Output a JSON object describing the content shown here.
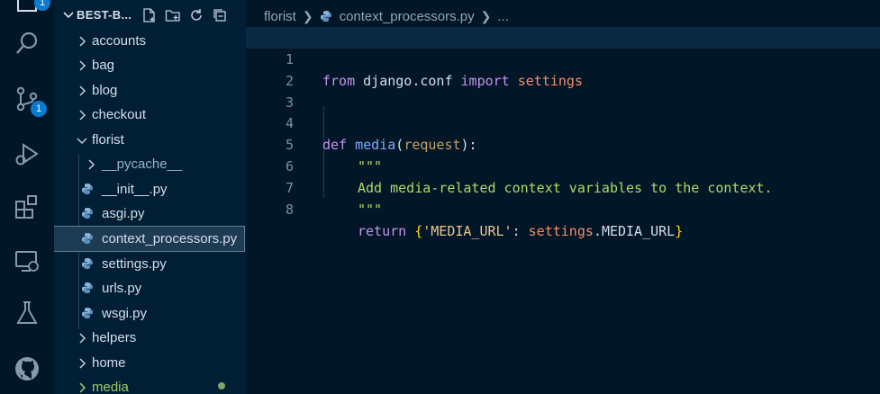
{
  "sidebar": {
    "title": "BEST-B...",
    "tree": [
      {
        "label": "accounts",
        "type": "folder"
      },
      {
        "label": "bag",
        "type": "folder"
      },
      {
        "label": "blog",
        "type": "folder"
      },
      {
        "label": "checkout",
        "type": "folder"
      },
      {
        "label": "florist",
        "type": "folder-open"
      },
      {
        "label": "__pycache__",
        "type": "folder"
      },
      {
        "label": "__init__.py",
        "type": "py"
      },
      {
        "label": "asgi.py",
        "type": "py"
      },
      {
        "label": "context_processors.py",
        "type": "py"
      },
      {
        "label": "settings.py",
        "type": "py"
      },
      {
        "label": "urls.py",
        "type": "py"
      },
      {
        "label": "wsgi.py",
        "type": "py"
      },
      {
        "label": "helpers",
        "type": "folder"
      },
      {
        "label": "home",
        "type": "folder"
      },
      {
        "label": "media",
        "type": "folder"
      }
    ]
  },
  "activity": {
    "explorer_badge": "1",
    "scm_badge": "1"
  },
  "breadcrumb": {
    "folder": "florist",
    "file": "context_processors.py",
    "more": "..."
  },
  "editor": {
    "line_numbers": [
      "1",
      "2",
      "3",
      "4",
      "5",
      "6",
      "7",
      "8"
    ],
    "line1": {
      "kw_from": "from",
      "module": " django.conf ",
      "kw_import": "import",
      "name": " settings"
    },
    "line4": {
      "kw_def": "def",
      "fn": " media",
      "open": "(",
      "param": "request",
      "close": "):"
    },
    "line5": {
      "text": "\"\"\""
    },
    "line6": {
      "text": "Add media-related context variables to the context."
    },
    "line7": {
      "text": "\"\"\""
    },
    "line8": {
      "kw_return": "return",
      "open": " {",
      "key": "'MEDIA_URL'",
      "colon": ": ",
      "obj": "settings",
      "dot": ".",
      "attr": "MEDIA_URL",
      "close": "}"
    }
  },
  "colors": {
    "background": "#011627",
    "sidebar": "#011f34",
    "accent": "#0b7ad1"
  }
}
